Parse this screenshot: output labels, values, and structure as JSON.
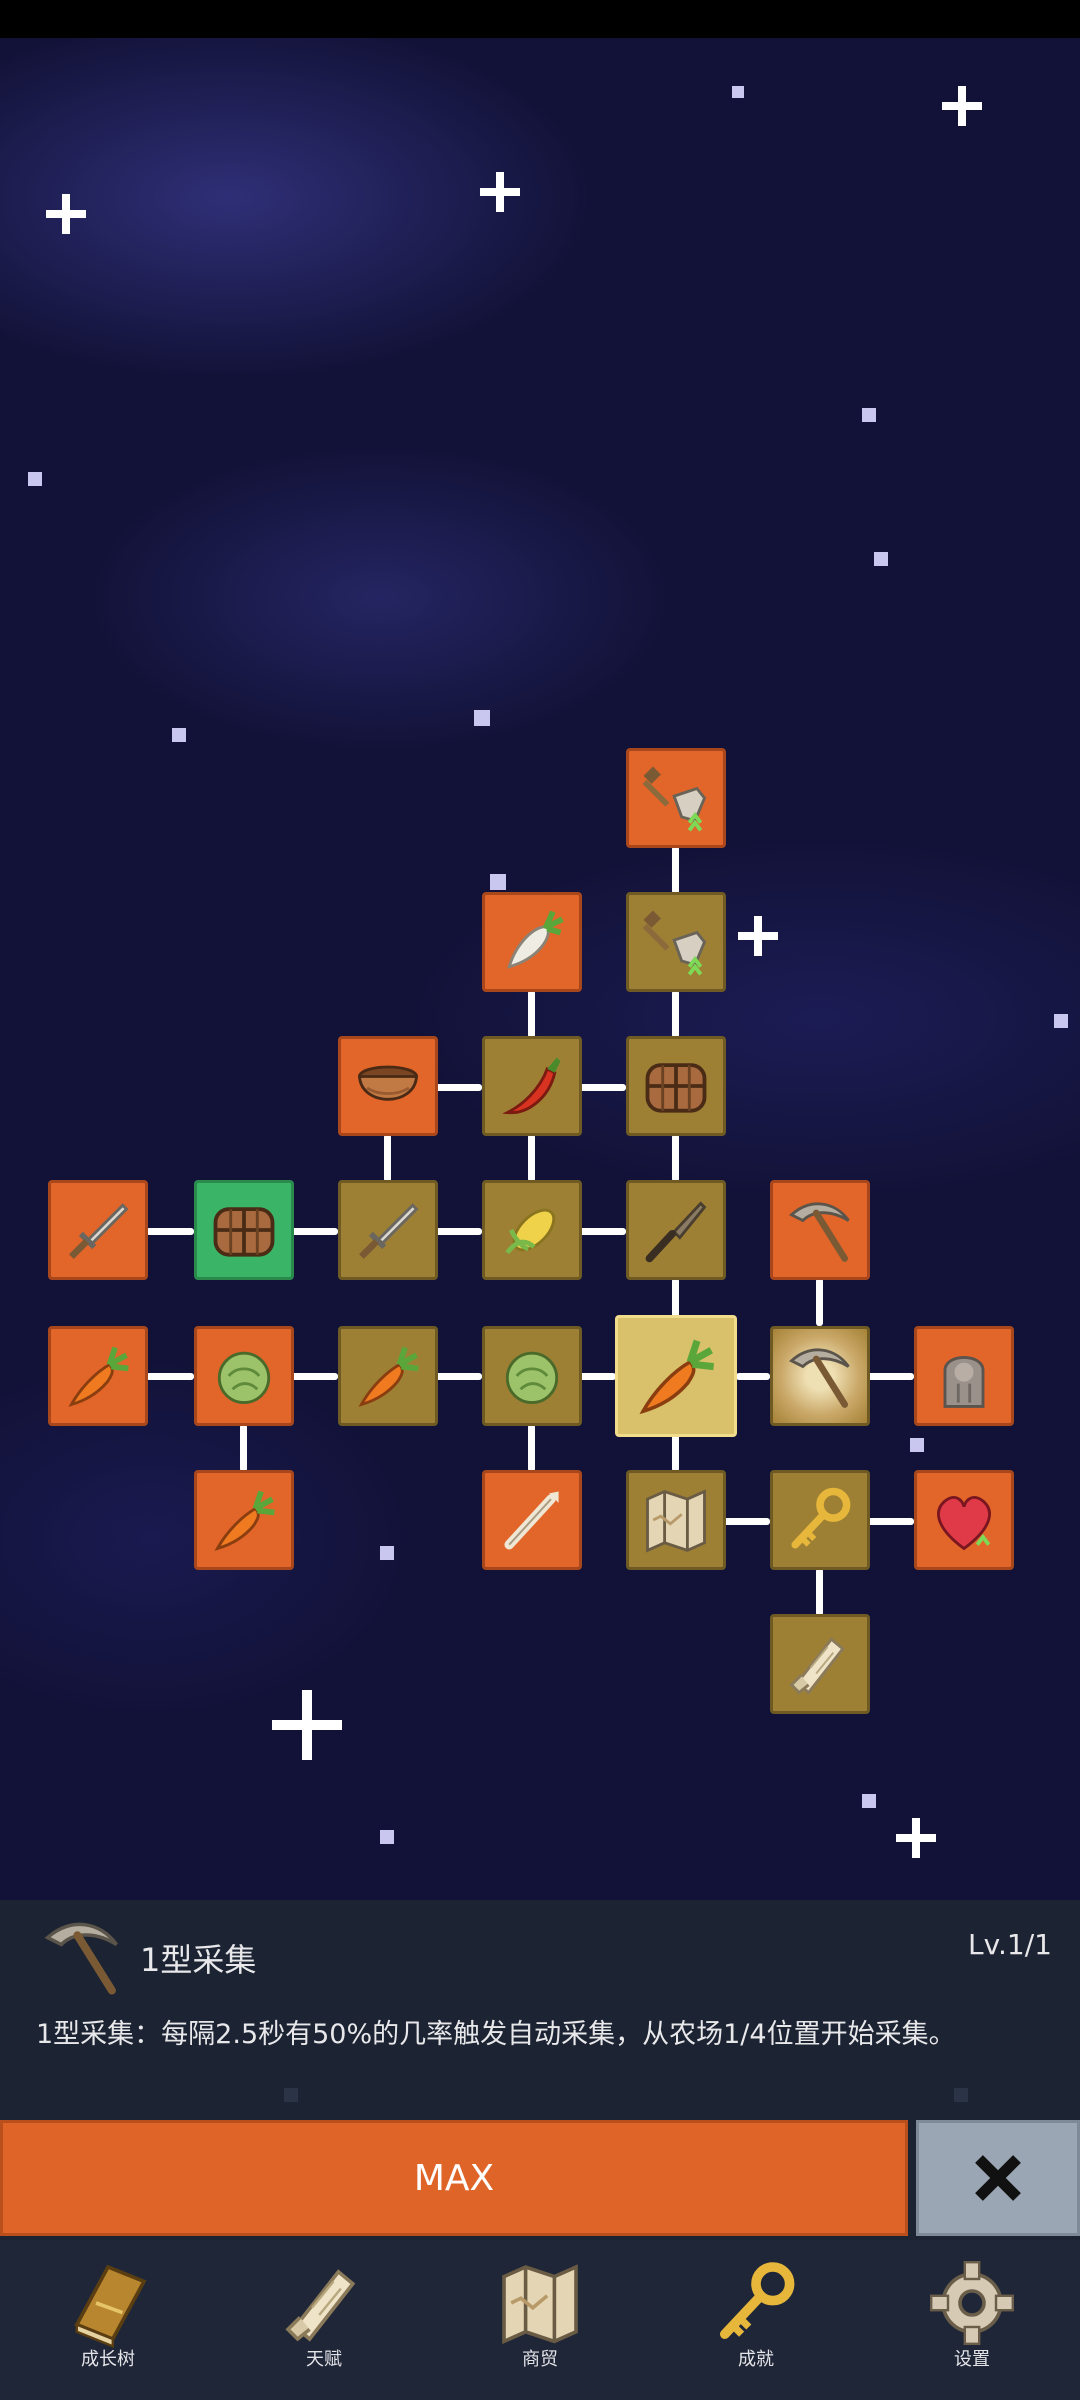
{
  "skill_tree": {
    "nodes": [
      {
        "id": "shovel-up-2",
        "icon": "shovel-icon",
        "style": "orange"
      },
      {
        "id": "radish",
        "icon": "radish-icon",
        "style": "orange"
      },
      {
        "id": "shovel-up-1",
        "icon": "shovel-icon",
        "style": "tan"
      },
      {
        "id": "bowl",
        "icon": "bowl-icon",
        "style": "orange"
      },
      {
        "id": "chili",
        "icon": "chili-pepper-icon",
        "style": "tan"
      },
      {
        "id": "chest-top",
        "icon": "chest-icon",
        "style": "tan"
      },
      {
        "id": "sword-left",
        "icon": "sword-icon",
        "style": "orange"
      },
      {
        "id": "chest-green",
        "icon": "chest-icon",
        "style": "green"
      },
      {
        "id": "sword-mid",
        "icon": "sword-icon",
        "style": "tan"
      },
      {
        "id": "corn",
        "icon": "corn-icon",
        "style": "tan"
      },
      {
        "id": "knife",
        "icon": "knife-icon",
        "style": "tan"
      },
      {
        "id": "pickaxe-up",
        "icon": "pickaxe-icon",
        "style": "orange"
      },
      {
        "id": "carrot-up-a",
        "icon": "carrot-icon",
        "style": "orange"
      },
      {
        "id": "cabbage-up",
        "icon": "cabbage-icon",
        "style": "orange"
      },
      {
        "id": "carrot-up-b",
        "icon": "carrot-icon",
        "style": "tan"
      },
      {
        "id": "cabbage",
        "icon": "cabbage-icon",
        "style": "tan"
      },
      {
        "id": "carrot-center",
        "icon": "carrot-icon",
        "style": "selected"
      },
      {
        "id": "pickaxe-selected",
        "icon": "pickaxe-icon",
        "style": "sunburst"
      },
      {
        "id": "statue",
        "icon": "statue-icon",
        "style": "orange"
      },
      {
        "id": "carrot-up-c",
        "icon": "carrot-icon",
        "style": "orange"
      },
      {
        "id": "bone",
        "icon": "bone-icon",
        "style": "orange"
      },
      {
        "id": "map",
        "icon": "map-icon",
        "style": "tan"
      },
      {
        "id": "key",
        "icon": "key-icon",
        "style": "tan"
      },
      {
        "id": "heart",
        "icon": "heart-icon",
        "style": "orange"
      },
      {
        "id": "scroll",
        "icon": "scroll-icon",
        "style": "tan"
      }
    ]
  },
  "detail": {
    "icon": "pickaxe-icon",
    "title": "1型采集",
    "level": "Lv.1/1",
    "description": "1型采集：每隔2.5秒有50%的几率触发自动采集，从农场1/4位置开始采集。"
  },
  "actions": {
    "max_label": "MAX",
    "close_icon": "close-icon"
  },
  "nav": {
    "items": [
      {
        "label": "成长树",
        "icon": "book-icon"
      },
      {
        "label": "天赋",
        "icon": "scroll-icon"
      },
      {
        "label": "商贸",
        "icon": "map-icon"
      },
      {
        "label": "成就",
        "icon": "key-icon"
      },
      {
        "label": "设置",
        "icon": "gear-icon"
      }
    ]
  },
  "colors": {
    "orange_node": "#e2652a",
    "tan_node": "#9e8035",
    "green_node": "#3ab567",
    "max_button": "#df6428",
    "close_button": "#9aa6b4",
    "panel_bg": "#1c2333"
  }
}
